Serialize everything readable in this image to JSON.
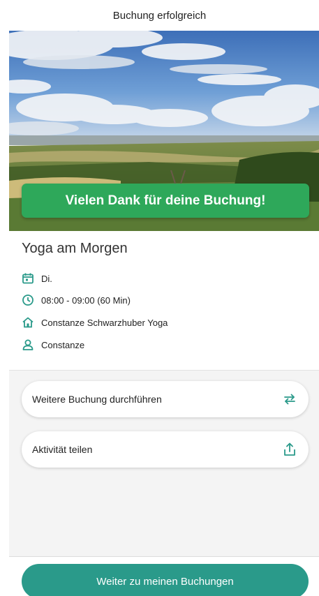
{
  "header": {
    "title": "Buchung erfolgreich"
  },
  "hero": {
    "banner_text": "Vielen Dank für deine Buchung!"
  },
  "booking": {
    "title": "Yoga am Morgen",
    "day": "Di.",
    "time": "08:00 - 09:00 (60 Min)",
    "studio": "Constanze Schwarzhuber Yoga",
    "instructor": "Constanze"
  },
  "actions": {
    "book_again_label": "Weitere Buchung durchführen",
    "share_label": "Aktivität teilen"
  },
  "footer": {
    "primary_label": "Weiter zu meinen Buchungen"
  },
  "colors": {
    "accent": "#2a9a8a",
    "banner": "#2ea85a"
  },
  "icons": {
    "day": "calendar-icon",
    "time": "clock-icon",
    "studio": "home-icon",
    "instructor": "user-icon",
    "book_again": "swap-arrows-icon",
    "share": "share-upload-icon"
  }
}
